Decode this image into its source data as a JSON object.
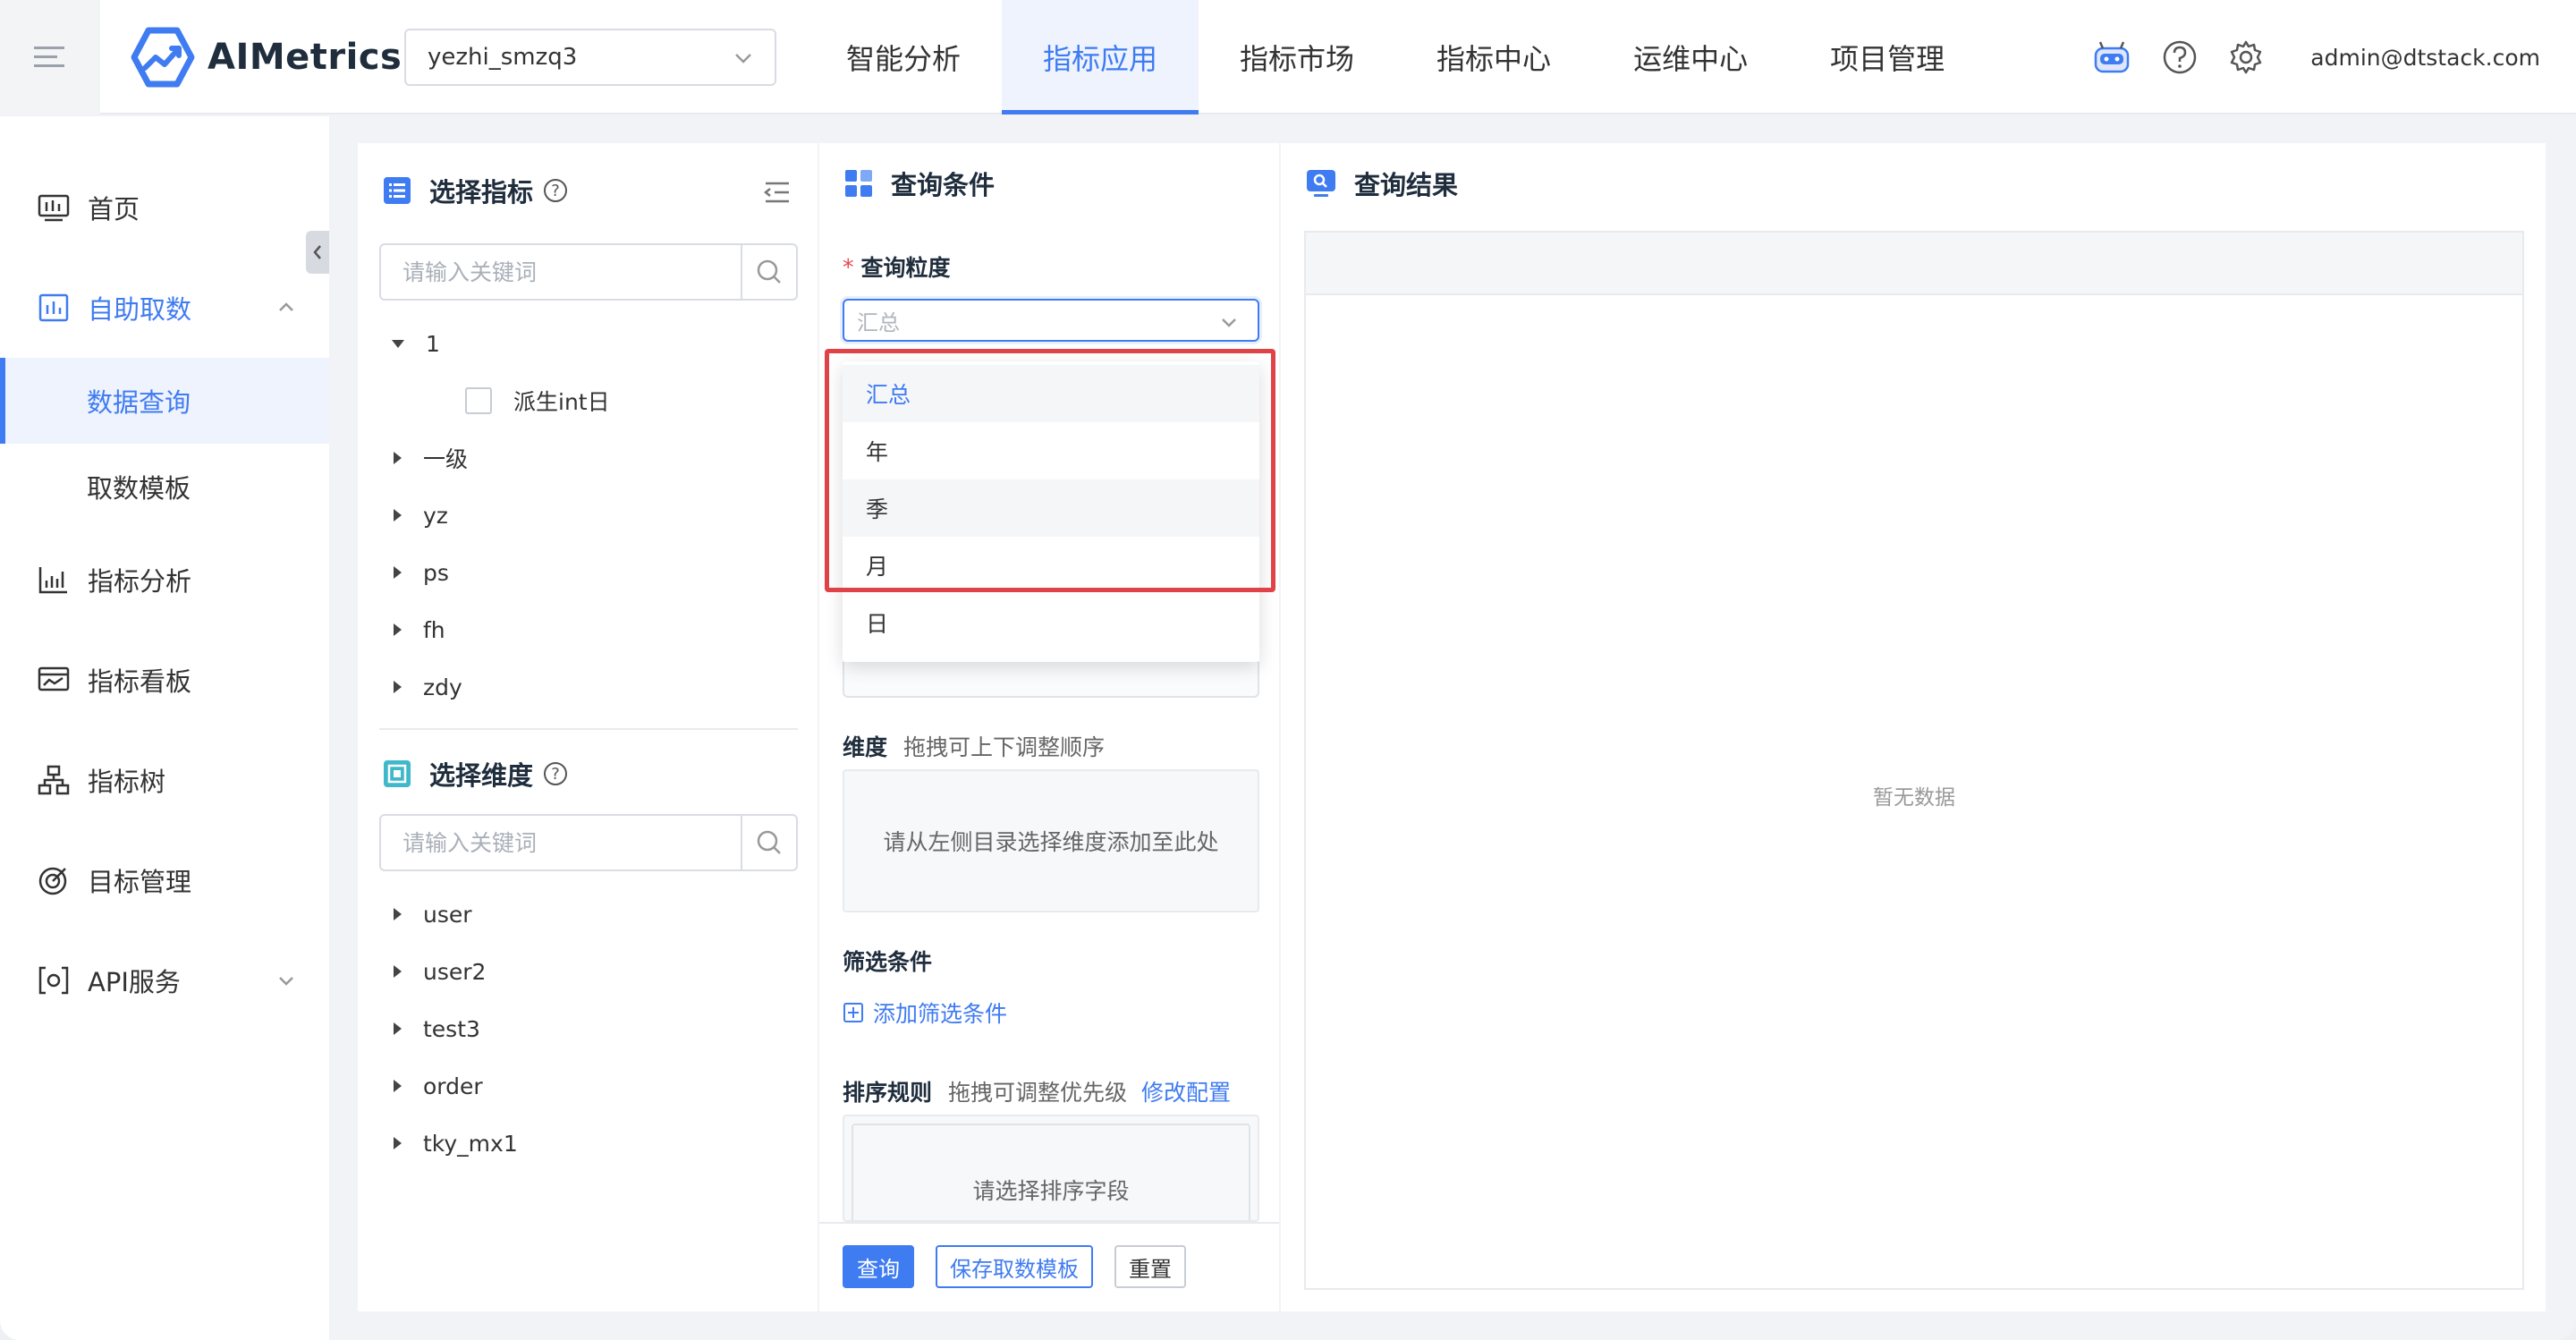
{
  "app": {
    "name": "AIMetrics",
    "user": "admin@dtstack.com"
  },
  "project": {
    "value": "yezhi_smzq3"
  },
  "nav": [
    {
      "label": "智能分析",
      "active": false
    },
    {
      "label": "指标应用",
      "active": true
    },
    {
      "label": "指标市场",
      "active": false
    },
    {
      "label": "指标中心",
      "active": false
    },
    {
      "label": "运维中心",
      "active": false
    },
    {
      "label": "项目管理",
      "active": false
    }
  ],
  "sidebar": {
    "items": [
      {
        "label": "首页",
        "icon": "dashboard-icon"
      },
      {
        "label": "自助取数",
        "icon": "self-service-icon",
        "expanded": true
      },
      {
        "label": "数据查询",
        "sub": true,
        "active": true
      },
      {
        "label": "取数模板",
        "sub": true
      },
      {
        "label": "指标分析",
        "icon": "chart-icon"
      },
      {
        "label": "指标看板",
        "icon": "board-icon"
      },
      {
        "label": "指标树",
        "icon": "tree-icon"
      },
      {
        "label": "目标管理",
        "icon": "target-icon"
      },
      {
        "label": "API服务",
        "icon": "api-icon",
        "expanded": false
      }
    ]
  },
  "metric_panel": {
    "title": "选择指标",
    "search_placeholder": "请输入关键词",
    "tree": [
      {
        "label": "1",
        "expanded": true,
        "children": [
          {
            "label": "派生int日"
          }
        ]
      },
      {
        "label": "一级"
      },
      {
        "label": "yz"
      },
      {
        "label": "ps"
      },
      {
        "label": "fh"
      },
      {
        "label": "zdy"
      }
    ]
  },
  "dimension_panel": {
    "title": "选择维度",
    "search_placeholder": "请输入关键词",
    "tree": [
      {
        "label": "user"
      },
      {
        "label": "user2"
      },
      {
        "label": "test3"
      },
      {
        "label": "order"
      },
      {
        "label": "tky_mx1"
      }
    ]
  },
  "query_panel": {
    "title": "查询条件",
    "granularity_label": "查询粒度",
    "granularity_placeholder": "汇总",
    "granularity_options": [
      "汇总",
      "年",
      "季",
      "月",
      "日"
    ],
    "dimension_label": "维度",
    "dimension_hint": "拖拽可上下调整顺序",
    "dimension_placeholder": "请从左侧目录选择维度添加至此处",
    "filter_label": "筛选条件",
    "add_filter": "添加筛选条件",
    "sort_label": "排序规则",
    "sort_hint": "拖拽可调整优先级",
    "sort_link": "修改配置",
    "sort_placeholder": "请选择排序字段",
    "buttons": {
      "query": "查询",
      "save_template": "保存取数模板",
      "reset": "重置"
    }
  },
  "result_panel": {
    "title": "查询结果",
    "empty": "暂无数据"
  },
  "colors": {
    "accent": "#3f7bf1",
    "highlight": "#e04347"
  }
}
